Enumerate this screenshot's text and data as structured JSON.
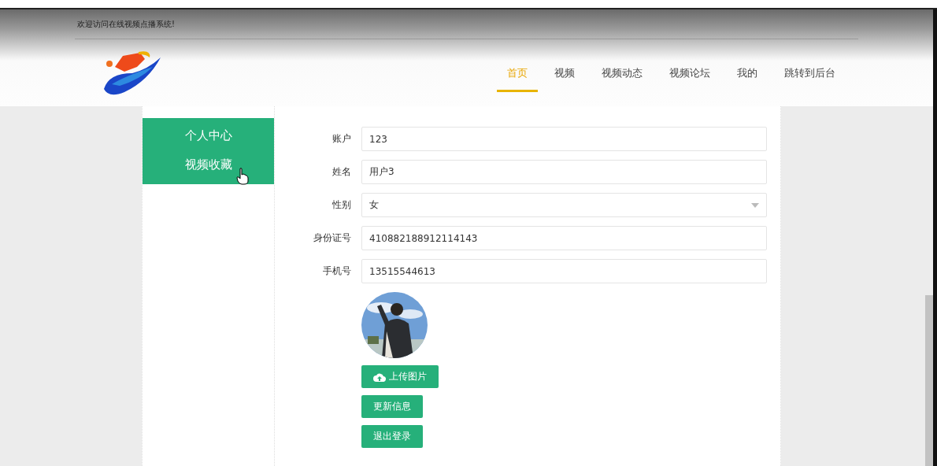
{
  "top_bar": {
    "welcome": "欢迎访问在线视频点播系统!"
  },
  "nav": {
    "items": [
      {
        "label": "首页",
        "selected": true
      },
      {
        "label": "视频",
        "selected": false
      },
      {
        "label": "视频动态",
        "selected": false
      },
      {
        "label": "视频论坛",
        "selected": false
      },
      {
        "label": "我的",
        "selected": false
      },
      {
        "label": "跳转到后台",
        "selected": false
      }
    ]
  },
  "sidebar": {
    "items": [
      {
        "label": "个人中心"
      },
      {
        "label": "视频收藏"
      }
    ]
  },
  "form": {
    "fields": [
      {
        "label": "账户",
        "kind": "input",
        "value": "123"
      },
      {
        "label": "姓名",
        "kind": "input",
        "value": "用户3"
      },
      {
        "label": "性别",
        "kind": "select",
        "value": "女"
      },
      {
        "label": "身份证号",
        "kind": "input",
        "value": "410882188912114143"
      },
      {
        "label": "手机号",
        "kind": "input",
        "value": "13515544613"
      }
    ],
    "upload_button": "上传图片",
    "buttons": [
      "更新信息",
      "退出登录"
    ]
  }
}
